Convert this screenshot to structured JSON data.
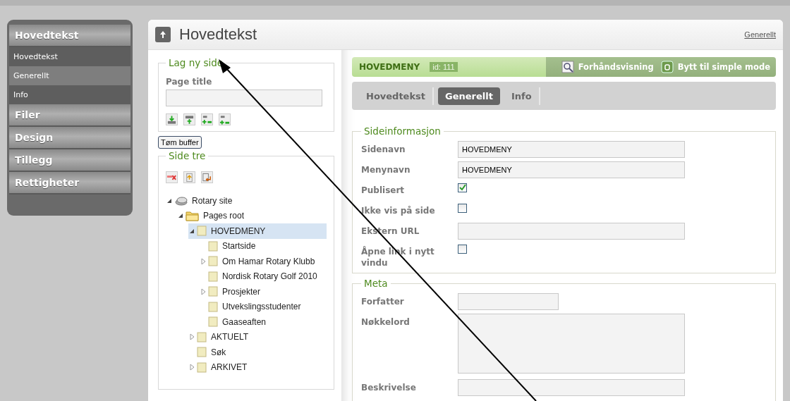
{
  "sidebar": {
    "sections": [
      {
        "label": "Hovedtekst",
        "items": [
          {
            "label": "Hovedtekst",
            "selected": false
          },
          {
            "label": "Generellt",
            "selected": true
          },
          {
            "label": "Info",
            "selected": false
          }
        ]
      },
      {
        "label": "Filer"
      },
      {
        "label": "Design"
      },
      {
        "label": "Tillegg"
      },
      {
        "label": "Rettigheter"
      }
    ]
  },
  "header": {
    "title": "Hovedtekst",
    "link": "Generellt"
  },
  "new_page": {
    "legend": "Lag ny side",
    "field_label": "Page title"
  },
  "clear_button": "Tøm buffer",
  "tree": {
    "legend": "Side tre",
    "nodes": [
      {
        "label": "Rotary site",
        "kind": "site",
        "expanded": true,
        "selected": false,
        "children": [
          {
            "label": "Pages root",
            "kind": "folder",
            "expanded": true,
            "selected": false,
            "children": [
              {
                "label": "HOVEDMENY",
                "kind": "page",
                "expanded": true,
                "selected": true,
                "children": [
                  {
                    "label": "Startside",
                    "kind": "page",
                    "selected": false
                  },
                  {
                    "label": "Om Hamar Rotary Klubb",
                    "kind": "page",
                    "expanded": false,
                    "selected": false
                  },
                  {
                    "label": "Nordisk Rotary Golf 2010",
                    "kind": "page",
                    "selected": false
                  },
                  {
                    "label": "Prosjekter",
                    "kind": "page",
                    "expanded": false,
                    "selected": false
                  },
                  {
                    "label": "Utvekslingsstudenter",
                    "kind": "page",
                    "selected": false
                  },
                  {
                    "label": "Gaaseaften",
                    "kind": "page",
                    "selected": false
                  }
                ]
              },
              {
                "label": "AKTUELT",
                "kind": "page",
                "expanded": false,
                "selected": false
              },
              {
                "label": "Søk",
                "kind": "page",
                "selected": false
              },
              {
                "label": "ARKIVET",
                "kind": "page",
                "expanded": false,
                "selected": false
              }
            ]
          }
        ]
      }
    ]
  },
  "page_bar": {
    "name": "HOVEDMENY",
    "id_badge": "id: 111",
    "actions": [
      "Forhåndsvisning",
      "Bytt til simple mode"
    ]
  },
  "tabs": [
    {
      "label": "Hovedtekst",
      "selected": false
    },
    {
      "label": "Generellt",
      "selected": true
    },
    {
      "label": "Info",
      "selected": false
    }
  ],
  "fieldsets": [
    {
      "legend": "Sideinformasjon",
      "fields": [
        {
          "label": "Sidenavn",
          "kind": "text",
          "value": "HOVEDMENY"
        },
        {
          "label": "Menynavn",
          "kind": "text",
          "value": "HOVEDMENY"
        },
        {
          "label": "Publisert",
          "kind": "checkbox",
          "checked": true
        },
        {
          "label": "Ikke vis på side",
          "kind": "checkbox",
          "checked": false
        },
        {
          "label": "Ekstern URL",
          "kind": "text"
        },
        {
          "label": "Åpne link i nytt vindu",
          "kind": "checkbox",
          "checked": false
        }
      ]
    },
    {
      "legend": "Meta",
      "fields": [
        {
          "label": "Forfatter",
          "kind": "short"
        },
        {
          "label": "Nøkkelord",
          "kind": "textarea"
        },
        {
          "label": "Beskrivelse",
          "kind": "text"
        }
      ]
    }
  ]
}
